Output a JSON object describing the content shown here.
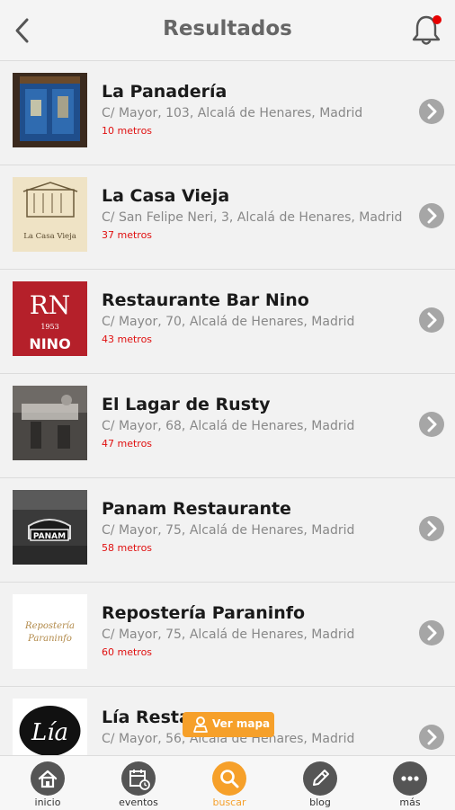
{
  "header": {
    "title": "Resultados",
    "back_icon": "chevron-left-icon",
    "notification_icon": "bell-icon",
    "notification_badge_color": "#e60000"
  },
  "results": [
    {
      "name": "La Panadería",
      "address": "C/ Mayor, 103, Alcalá de Henares, Madrid",
      "distance": "10 metros"
    },
    {
      "name": "La Casa Vieja",
      "address": "C/ San Felipe Neri, 3, Alcalá de Henares, Madrid",
      "distance": "37 metros",
      "logo_text": "La Casa Vieja"
    },
    {
      "name": "Restaurante Bar Nino",
      "address": "C/ Mayor, 70, Alcalá de Henares, Madrid",
      "distance": "43 metros",
      "logo_text": "NINO",
      "logo_year": "1953"
    },
    {
      "name": "El Lagar de Rusty",
      "address": "C/ Mayor, 68, Alcalá de Henares, Madrid",
      "distance": "47 metros"
    },
    {
      "name": "Panam Restaurante",
      "address": "C/ Mayor, 75, Alcalá de Henares, Madrid",
      "distance": "58 metros",
      "logo_text": "PANAM"
    },
    {
      "name": "Repostería Paraninfo",
      "address": "C/ Mayor, 75, Alcalá de Henares, Madrid",
      "distance": "60 metros"
    },
    {
      "name": "Lía Resta",
      "address": "C/ Mayor, 56, Alcalá de Henares, Madrid",
      "distance": ""
    }
  ],
  "map_button": {
    "label": "Ver mapa",
    "icon": "map-pin-icon"
  },
  "bottom_nav": [
    {
      "label": "inicio",
      "icon": "home-icon",
      "active": false
    },
    {
      "label": "eventos",
      "icon": "calendar-icon",
      "active": false
    },
    {
      "label": "buscar",
      "icon": "search-icon",
      "active": true
    },
    {
      "label": "blog",
      "icon": "pencil-icon",
      "active": false
    },
    {
      "label": "más",
      "icon": "more-icon",
      "active": false
    }
  ],
  "colors": {
    "accent": "#f6a02a",
    "distance": "#e01010",
    "chevron": "#a6a6a6",
    "nav_icon": "#555555"
  }
}
